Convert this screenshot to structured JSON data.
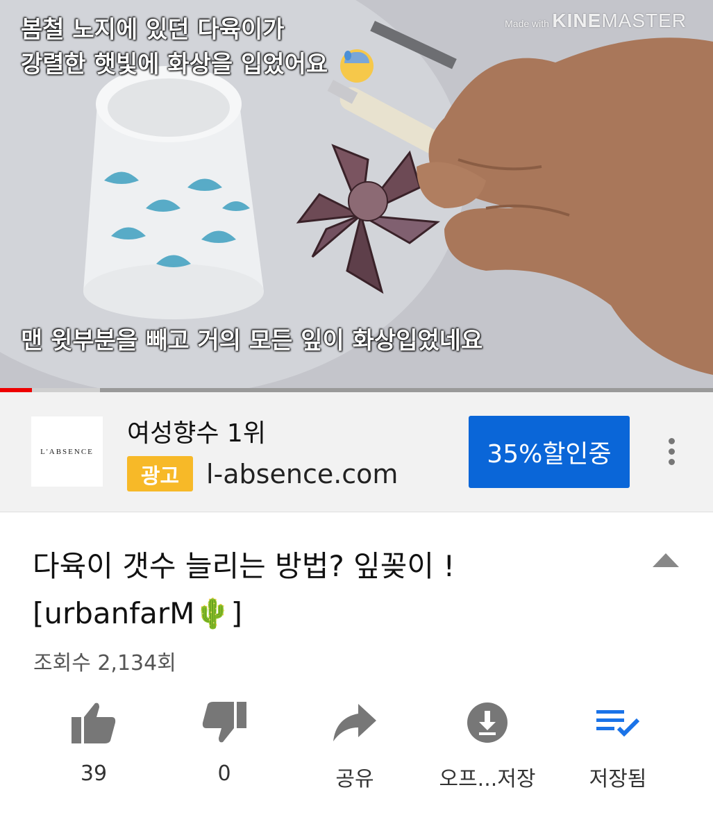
{
  "video": {
    "caption_top_line1": "봄철 노지에 있던 다육이가",
    "caption_top_line2": "강렬한 햇빛에 화상을 입었어요",
    "caption_bottom": "맨 윗부분을 빼고 거의 모든 잎이 화상입었네요",
    "watermark_small": "Made with",
    "watermark_brand_bold": "KINE",
    "watermark_brand_rest": "MASTER",
    "progress_fraction": 0.045,
    "buffer_fraction": 0.14,
    "progress_color": "#ee0000"
  },
  "ad": {
    "logo_text": "L'ABSENCE",
    "title": "여성향수 1위",
    "badge": "광고",
    "domain": "l-absence.com",
    "cta": "35%할인중",
    "cta_color": "#0a66d8",
    "badge_color": "#f7b928",
    "more_icon": "more-vert-icon"
  },
  "info": {
    "title_line1": "다육이 갯수 늘리는 방법? 잎꽂이 !",
    "title_line2": "[urbanfarM🌵]",
    "views": "조회수 2,134회"
  },
  "actions": [
    {
      "icon": "thumbs-up-icon",
      "label": "39"
    },
    {
      "icon": "thumbs-down-icon",
      "label": "0"
    },
    {
      "icon": "share-icon",
      "label": "공유"
    },
    {
      "icon": "download-icon",
      "label": "오프...저장"
    },
    {
      "icon": "playlist-saved-icon",
      "label": "저장됨",
      "color": "#1a73e8"
    }
  ]
}
